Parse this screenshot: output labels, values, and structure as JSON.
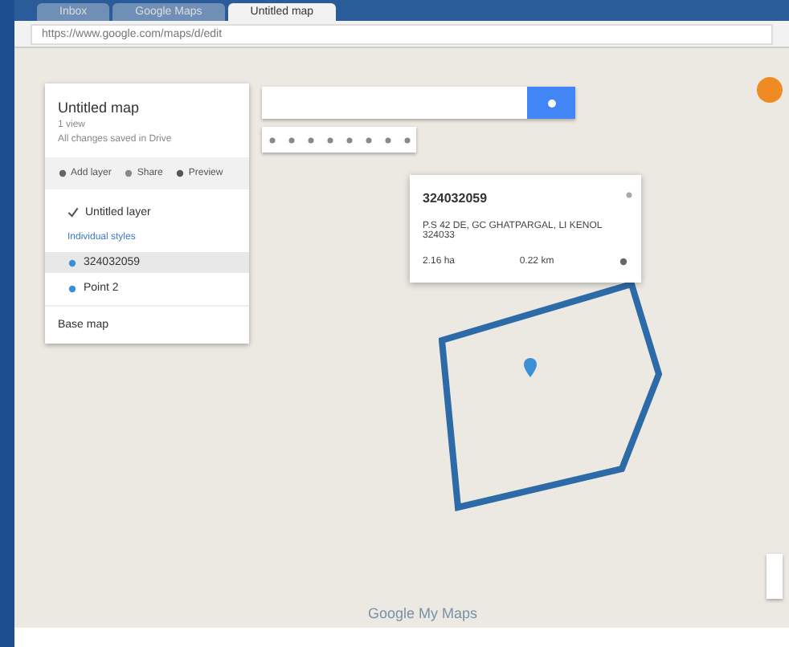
{
  "browser": {
    "tabs": [
      {
        "label": "Inbox",
        "selected": false
      },
      {
        "label": "Google Maps",
        "selected": false
      },
      {
        "label": "Untitled map",
        "selected": true
      }
    ],
    "url": "https://www.google.com/maps/d/edit"
  },
  "panel": {
    "title": "Untitled map",
    "subtitle": "1 view",
    "status": "All changes saved in Drive",
    "actions": [
      {
        "kind": "layer",
        "label": "Add layer"
      },
      {
        "kind": "share",
        "label": "Share"
      },
      {
        "kind": "preview",
        "label": "Preview"
      }
    ],
    "layer": {
      "name": "Untitled layer",
      "checked": true,
      "style": "Individual styles",
      "items": [
        {
          "label": "324032059",
          "selected": true
        },
        {
          "label": "Point 2",
          "selected": false
        }
      ]
    },
    "base_map": "Base map"
  },
  "popup": {
    "title": "324032059",
    "text": "P.S 42 DE, GC GHATPARGAL, LI KENOL 324033",
    "stats": [
      "2.16 ha",
      "0.22 km"
    ]
  },
  "brand": "Google My Maps"
}
